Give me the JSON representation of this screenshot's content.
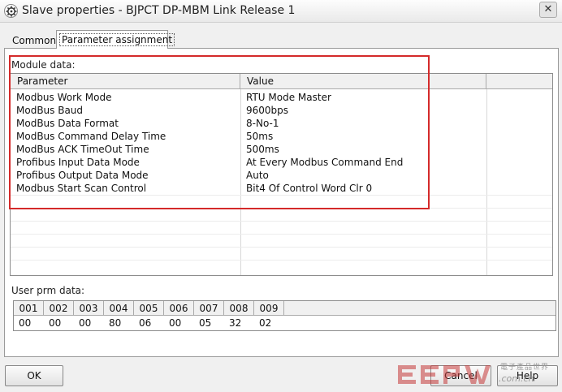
{
  "window": {
    "title": "Slave properties - BJPCT DP-MBM Link Release 1",
    "close_glyph": "✕",
    "icon": "gear-icon"
  },
  "tabs": [
    {
      "label": "Common",
      "active": false
    },
    {
      "label": "Parameter assignment",
      "active": true
    }
  ],
  "module_data": {
    "label": "Module data:",
    "columns": [
      "Parameter",
      "Value"
    ],
    "rows": [
      {
        "parameter": "Modbus Work Mode",
        "value": "RTU Mode Master"
      },
      {
        "parameter": "ModBus Baud",
        "value": "9600bps"
      },
      {
        "parameter": "ModBus Data Format",
        "value": "8-No-1"
      },
      {
        "parameter": "ModBus Command Delay Time",
        "value": "50ms"
      },
      {
        "parameter": "ModBus ACK TimeOut Time",
        "value": "500ms"
      },
      {
        "parameter": "Profibus Input Data Mode",
        "value": "At Every Modbus Command End"
      },
      {
        "parameter": "Profibus Output Data Mode",
        "value": "Auto"
      },
      {
        "parameter": "Modbus Start Scan Control",
        "value": "Bit4 Of Control Word Clr 0"
      }
    ],
    "highlight_color": "#d42a2a"
  },
  "user_prm_data": {
    "label": "User prm data:",
    "columns": [
      "001",
      "002",
      "003",
      "004",
      "005",
      "006",
      "007",
      "008",
      "009"
    ],
    "values": [
      "00",
      "00",
      "00",
      "80",
      "06",
      "00",
      "05",
      "32",
      "02"
    ]
  },
  "buttons": {
    "ok": "OK",
    "cancel": "Cancel",
    "help": "Help"
  },
  "watermark": {
    "logo_text": "EEPW",
    "chinese_text": "電子產品世界",
    "url": ".com.cn"
  }
}
